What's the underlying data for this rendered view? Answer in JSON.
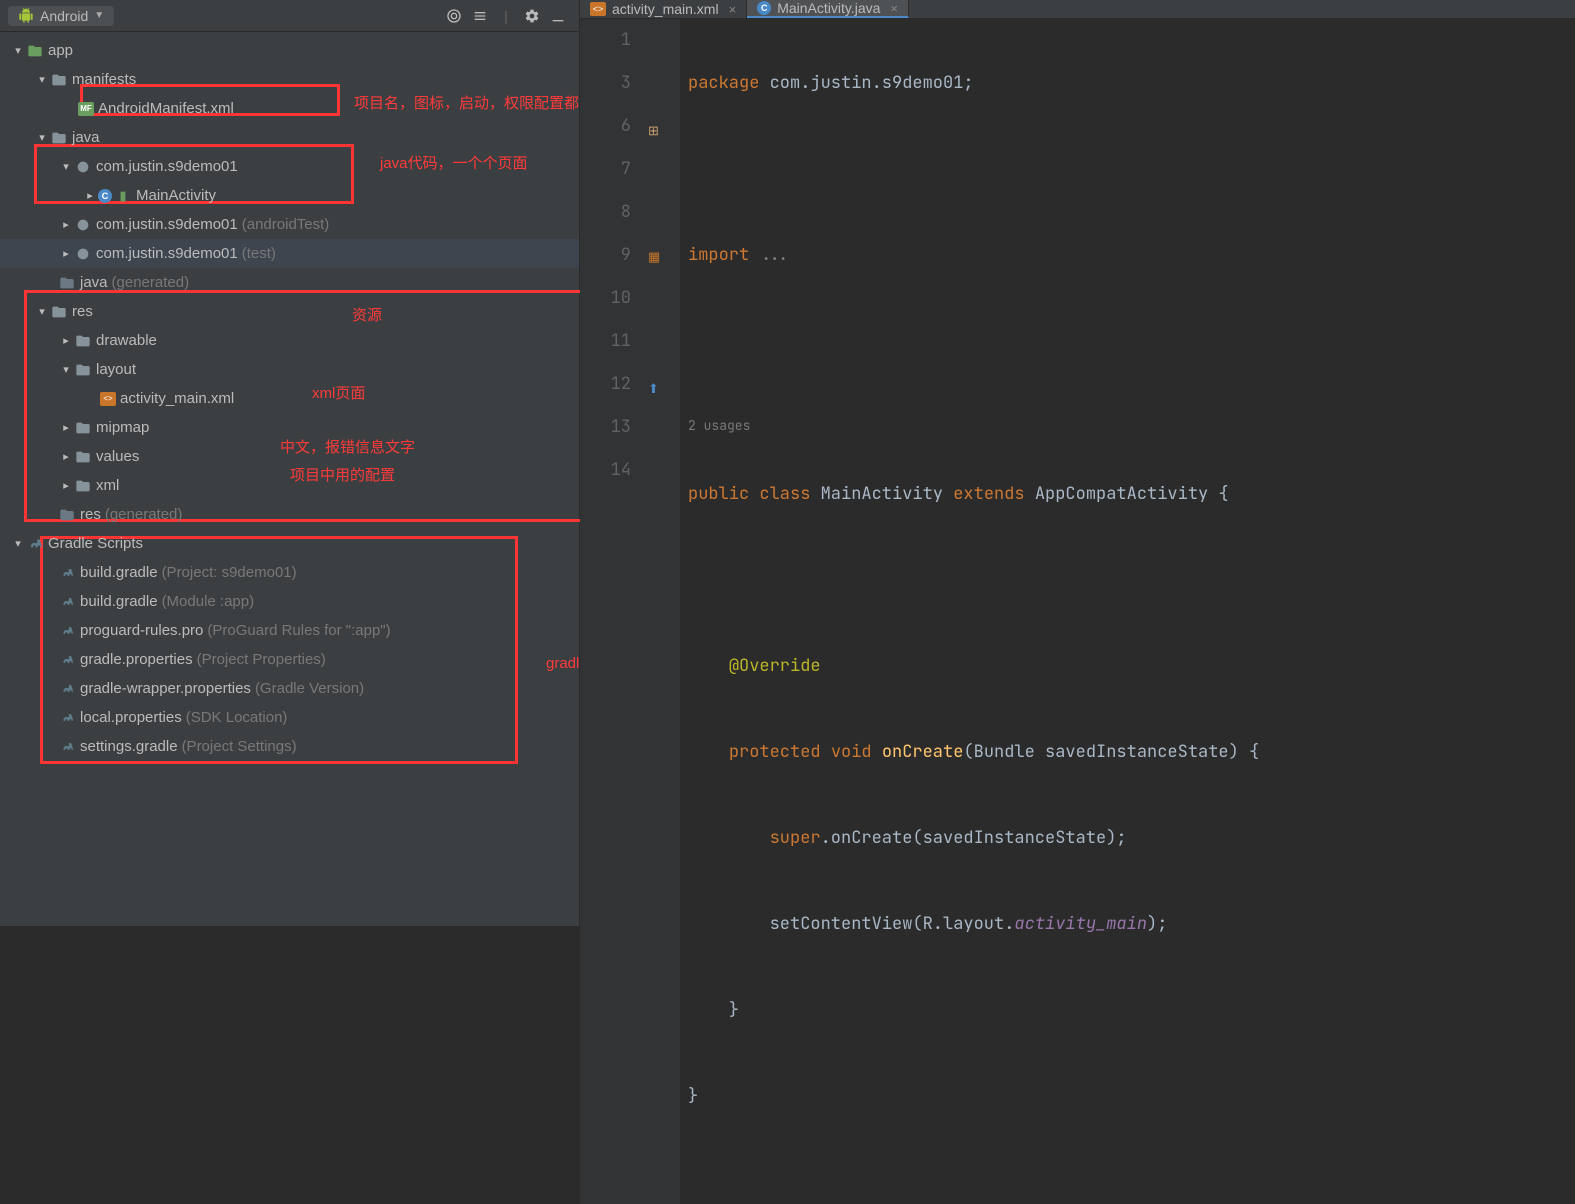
{
  "panel": {
    "view_mode": "Android",
    "tools": [
      "target-icon",
      "flatten-icon",
      "sort-icon",
      "gear-icon",
      "minimize-icon"
    ]
  },
  "tree": {
    "app": "app",
    "manifests": "manifests",
    "manifest_file": "AndroidManifest.xml",
    "java": "java",
    "pkg_main": "com.justin.s9demo01",
    "main_activity": "MainActivity",
    "pkg_android_test": "com.justin.s9demo01",
    "android_test_suffix": "(androidTest)",
    "pkg_test": "com.justin.s9demo01",
    "test_suffix": "(test)",
    "java_gen": "java",
    "generated": "(generated)",
    "res": "res",
    "drawable": "drawable",
    "layout": "layout",
    "activity_main_xml": "activity_main.xml",
    "mipmap": "mipmap",
    "values": "values",
    "xml": "xml",
    "res_gen": "res",
    "gradle_scripts": "Gradle Scripts",
    "gradle_items": [
      {
        "name": "build.gradle",
        "suffix": "(Project: s9demo01)"
      },
      {
        "name": "build.gradle",
        "suffix": "(Module :app)"
      },
      {
        "name": "proguard-rules.pro",
        "suffix": "(ProGuard Rules for \":app\")"
      },
      {
        "name": "gradle.properties",
        "suffix": "(Project Properties)"
      },
      {
        "name": "gradle-wrapper.properties",
        "suffix": "(Gradle Version)"
      },
      {
        "name": "local.properties",
        "suffix": "(SDK Location)"
      },
      {
        "name": "settings.gradle",
        "suffix": "(Project Settings)"
      }
    ]
  },
  "annotations": {
    "manifest": "项目名，图标，启动，权限配置都在这",
    "java_code": "java代码，一个个页面",
    "res": "资源",
    "xml_page": "xml页面",
    "values": "中文，报错信息文字",
    "xml_config": "项目中用的配置",
    "gradle": "gradle的一些配置"
  },
  "tabs": {
    "t1": "activity_main.xml",
    "t2": "MainActivity.java"
  },
  "code": {
    "line1_kw": "package",
    "line1_rest": " com.justin.s9demo01;",
    "line3_kw": "import",
    "line3_rest": " ...",
    "usages": "2 usages",
    "line7_public": "public ",
    "line7_class": "class ",
    "line7_name": "MainActivity ",
    "line7_extends": "extends ",
    "line7_parent": "AppCompatActivity {",
    "line9_ann": "@Override",
    "line10_protected": "protected ",
    "line10_void": "void ",
    "line10_fn": "onCreate",
    "line10_sig": "(Bundle savedInstanceState) {",
    "line11": "super.onCreate(savedInstanceState);",
    "line11_super": "super",
    "line11_rest": ".onCreate(savedInstanceState);",
    "line12_a": "setContentView(R.layout.",
    "line12_b": "activity_main",
    "line12_c": ");",
    "line13": "}",
    "line14": "}"
  },
  "gutter_lines": [
    "1",
    "",
    "3",
    "6",
    "",
    "7",
    "8",
    "9",
    "10",
    "11",
    "12",
    "13",
    "14"
  ]
}
